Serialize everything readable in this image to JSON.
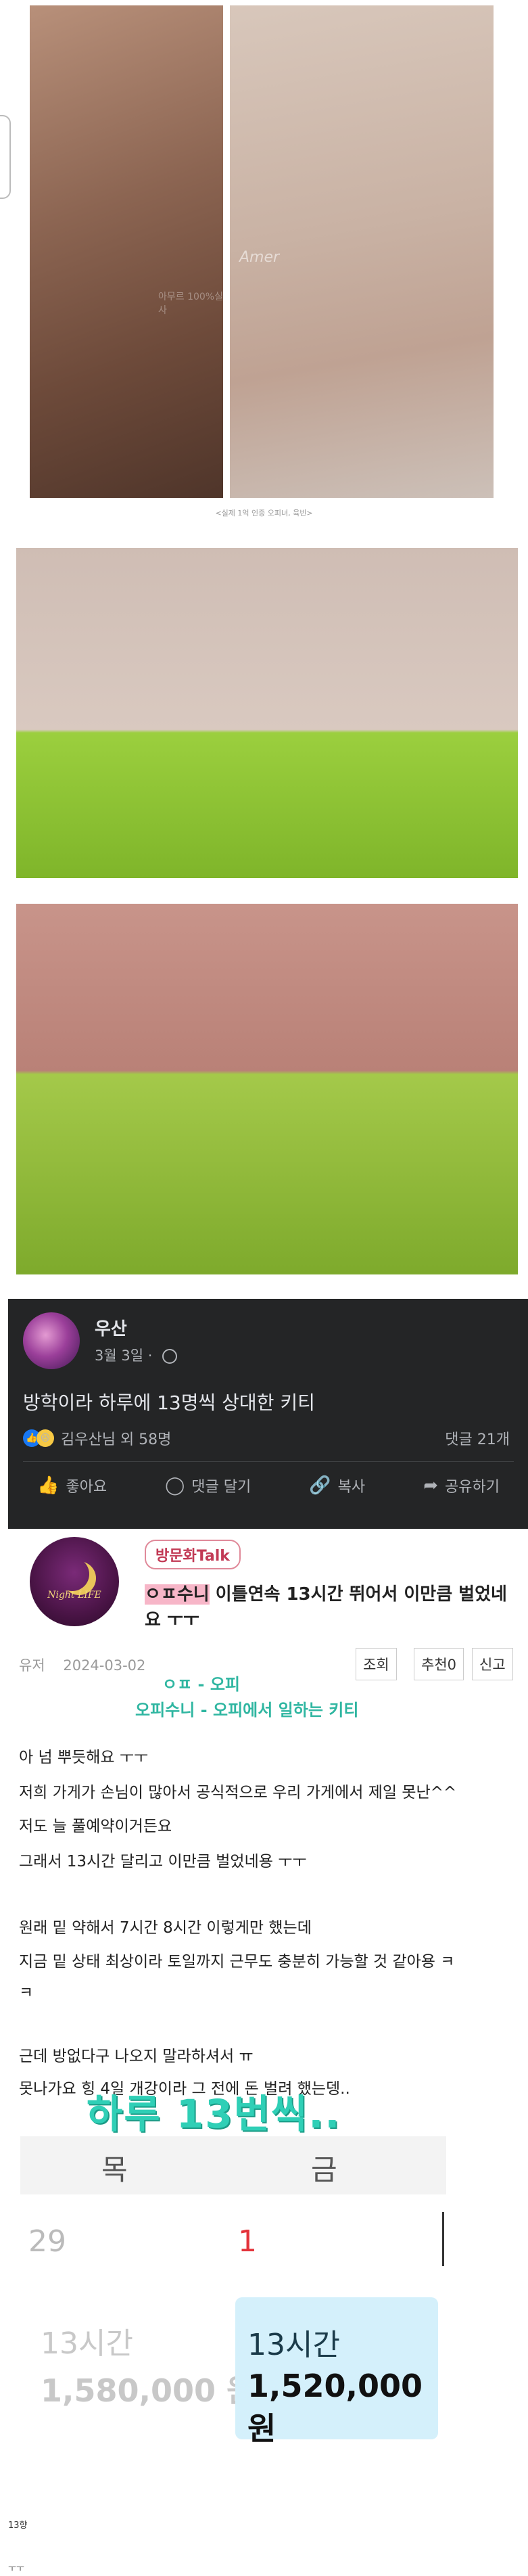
{
  "photos": {
    "caption": "<실제 1억 인증 오피녀, 육빈>",
    "watermark_left": "Amer",
    "watermark_left_sub": "아무르 100%실사"
  },
  "fb_post": {
    "author": "우산",
    "date": "3월 3일 · ",
    "title": "방학이라 하루에 13명씩 상대한 키티",
    "reactors": "김우산님 외 58명",
    "comments": "댓글 21개",
    "actions": {
      "like": "좋아요",
      "comment": "댓글 달기",
      "copy": "복사",
      "share": "공유하기"
    }
  },
  "community_post": {
    "avatar_text": "Night LIFE",
    "category": "방문화Talk",
    "title_highlight": "ㅇㅍ수니",
    "title_rest": " 이틀연속 13시간 뛰어서 이만큼 벌었네요 ㅜㅜ",
    "meta_author": "유저",
    "meta_date": "2024-03-02",
    "buttons": {
      "views": "조회",
      "recommend": "추천0",
      "report": "신고"
    },
    "annotation_1": "ㅇㅍ - 오피",
    "annotation_2": "오피수니 - 오피에서 일하는 키티",
    "body_lines": [
      "아 넘 뿌듯해요 ㅜㅜ",
      "저희 가게가 손님이 많아서 공식적으로 우리 가게에서 제일 못난^^",
      "저도 늘 풀예약이거든요",
      "그래서 13시간 달리고 이만큼 벌었네용 ㅜㅜ",
      "원래 밑 약해서 7시간 8시간 이렇게만 했는데",
      "지금 밑 상태 최상이라 토일까지 근무도 충분히 가능할 것 같아용 ㅋ",
      "ㅋ",
      "근데 방없다구 나오지 말라하셔서 ㅠ",
      "못나가요 힝 4일 개강이라 그 전에 돈 벌려 했는뎅.."
    ],
    "big_caption": "하루 13번씩.."
  },
  "calendar": {
    "day_left": "목",
    "day_right": "금",
    "date_left": "29",
    "date_right": "1",
    "hours_left": "13시간",
    "amount_left": "1,580,000 원",
    "hours_right": "13시간",
    "amount_right": "1,520,000 원",
    "highlight_color": "#d4f0fb"
  },
  "footer": {
    "line1": "13향",
    "line2": "ㅜㅜ"
  }
}
